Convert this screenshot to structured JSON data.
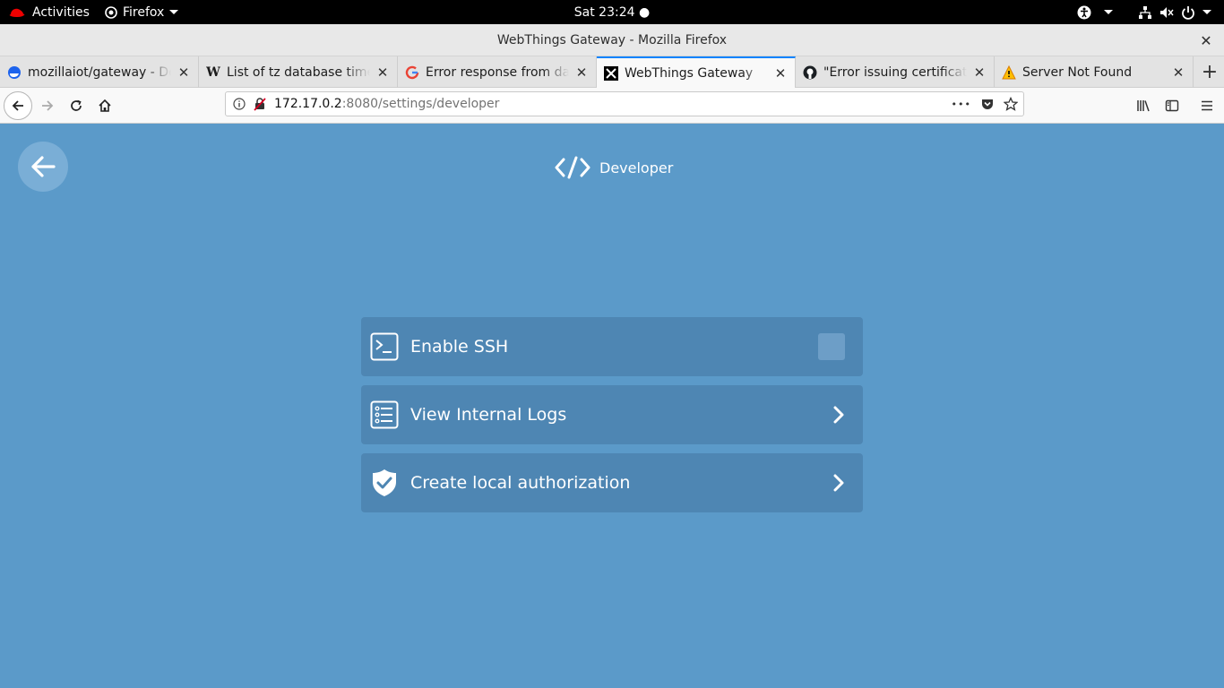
{
  "topbar": {
    "activities": "Activities",
    "app_name": "Firefox",
    "clock": "Sat 23:24 ●"
  },
  "window": {
    "title": "WebThings Gateway - Mozilla Firefox",
    "close": "✕"
  },
  "tabs": [
    {
      "label": "mozillaiot/gateway - Docker Hub",
      "icon": "docker-icon"
    },
    {
      "label": "List of tz database time zones",
      "icon": "wikipedia-icon"
    },
    {
      "label": "Error response from daemon",
      "icon": "google-icon"
    },
    {
      "label": "WebThings Gateway",
      "icon": "webthings-icon",
      "active": true
    },
    {
      "label": "\"Error issuing certificate\"",
      "icon": "github-icon"
    },
    {
      "label": "Server Not Found",
      "icon": "warning-icon"
    }
  ],
  "tab_close": "✕",
  "new_tab": "+",
  "url": {
    "host": "172.17.0.2",
    "path": ":8080/settings/developer",
    "more": "•••"
  },
  "page": {
    "title": "Developer",
    "items": [
      {
        "label": "Enable SSH",
        "icon": "terminal-icon",
        "control": "checkbox",
        "checked": false
      },
      {
        "label": "View Internal Logs",
        "icon": "list-icon",
        "control": "chevron"
      },
      {
        "label": "Create local authorization",
        "icon": "shield-check-icon",
        "control": "chevron"
      }
    ]
  },
  "colors": {
    "page_bg": "#5b9ac9",
    "row_bg": "#4e86b3",
    "accent": "#0a84ff"
  }
}
